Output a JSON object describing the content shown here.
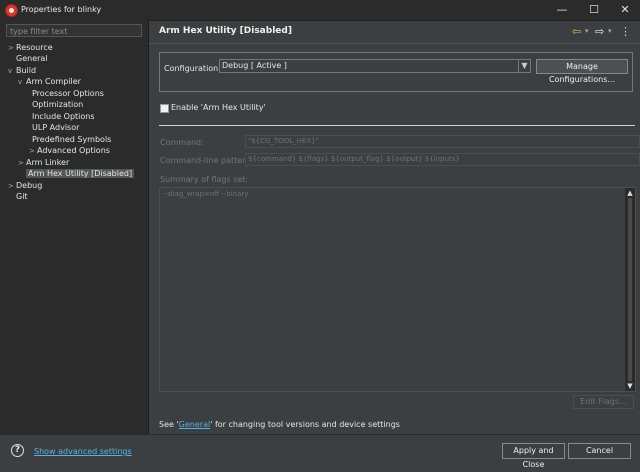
{
  "window": {
    "title": "Properties for blinky",
    "minimize_glyph": "—",
    "maximize_glyph": "☐",
    "close_glyph": "✕"
  },
  "filter": {
    "placeholder": "type filter text"
  },
  "tree": {
    "arrow_collapsed": ">",
    "arrow_expanded": "v",
    "items": [
      {
        "label": "Resource",
        "arrow": ">"
      },
      {
        "label": "General",
        "arrow": ""
      },
      {
        "label": "Build",
        "arrow": "v"
      },
      {
        "label": "Arm Compiler",
        "arrow": "v"
      },
      {
        "label": "Processor Options",
        "arrow": ""
      },
      {
        "label": "Optimization",
        "arrow": ""
      },
      {
        "label": "Include Options",
        "arrow": ""
      },
      {
        "label": "ULP Advisor",
        "arrow": ""
      },
      {
        "label": "Predefined Symbols",
        "arrow": ""
      },
      {
        "label": "Advanced Options",
        "arrow": ">"
      },
      {
        "label": "Arm Linker",
        "arrow": ">"
      },
      {
        "label": "Arm Hex Utility  [Disabled]",
        "arrow": "",
        "selected": true
      },
      {
        "label": "Debug",
        "arrow": ">"
      },
      {
        "label": "Git",
        "arrow": ""
      }
    ]
  },
  "page": {
    "title": "Arm Hex Utility  [Disabled]",
    "nav": {
      "back_glyph": "⇦",
      "forward_glyph": "⇨",
      "dropdown_glyph": "▾",
      "menu_glyph": "⋮"
    }
  },
  "configuration": {
    "label": "Configuration:",
    "value": "Debug  [ Active ]",
    "manage_button": "Manage Configurations..."
  },
  "enable": {
    "label": "Enable 'Arm Hex Utility'",
    "checked": false
  },
  "fields": {
    "command_label": "Command:",
    "command_value": "\"${CG_TOOL_HEX}\"",
    "pattern_label": "Command-line pattern:",
    "pattern_value": "${command} ${flags} ${output_flag} ${output} ${inputs}"
  },
  "summary": {
    "label": "Summary of flags set:",
    "value": "--diag_wrap=off --binary",
    "scroll_up": "▲",
    "scroll_down": "▼"
  },
  "edit_flags_button": "Edit Flags...",
  "general_note": {
    "prefix": "See '",
    "link": "General",
    "suffix": "' for changing tool versions and device settings"
  },
  "footer": {
    "help_glyph": "?",
    "advanced_link": "Show advanced settings",
    "apply_close_button": "Apply and Close",
    "cancel_button": "Cancel"
  }
}
